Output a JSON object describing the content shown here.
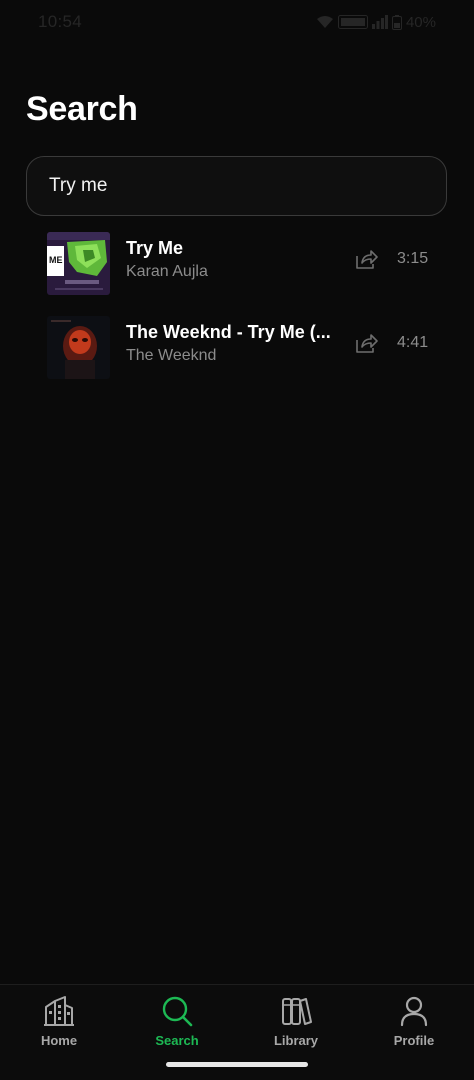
{
  "status_bar": {
    "time": "10:54",
    "battery": "40%"
  },
  "header": {
    "title": "Search"
  },
  "search": {
    "value": "Try me"
  },
  "results": [
    {
      "title": "Try Me",
      "artist": "Karan Aujla",
      "duration": "3:15",
      "cover_text": "ME"
    },
    {
      "title": "The Weeknd - Try Me (...",
      "artist": "The Weeknd",
      "duration": "4:41"
    }
  ],
  "nav": {
    "items": [
      {
        "label": "Home",
        "icon": "home-icon"
      },
      {
        "label": "Search",
        "icon": "search-icon"
      },
      {
        "label": "Library",
        "icon": "library-icon"
      },
      {
        "label": "Profile",
        "icon": "profile-icon"
      }
    ],
    "active": "Search"
  },
  "colors": {
    "accent": "#1db954",
    "background": "#0a0a0a",
    "secondary_text": "#8c8c8c"
  }
}
